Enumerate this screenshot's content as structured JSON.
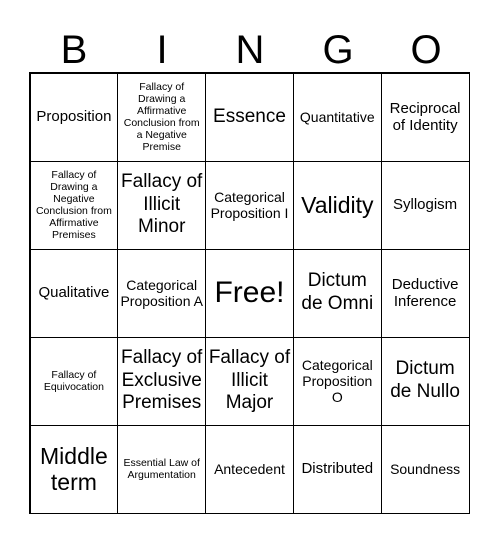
{
  "header": [
    "B",
    "I",
    "N",
    "G",
    "O"
  ],
  "cells": [
    "Proposition",
    "Fallacy of Drawing a Affirmative Conclusion from a Negative Premise",
    "Essence",
    "Quantitative",
    "Reciprocal of Identity",
    "Fallacy of Drawing a Negative Conclusion from Affirmative Premises",
    "Fallacy of Illicit Minor",
    "Categorical Proposition I",
    "Validity",
    "Syllogism",
    "Qualitative",
    "Categorical Proposition A",
    "Free!",
    "Dictum de Omni",
    "Deductive Inference",
    "Fallacy of Equivocation",
    "Fallacy of Exclusive Premises",
    "Fallacy of Illicit Major",
    "Categorical Proposition O",
    "Dictum de Nullo",
    "Middle term",
    "Essential Law of Argumentation",
    "Antecedent",
    "Distributed",
    "Soundness"
  ]
}
